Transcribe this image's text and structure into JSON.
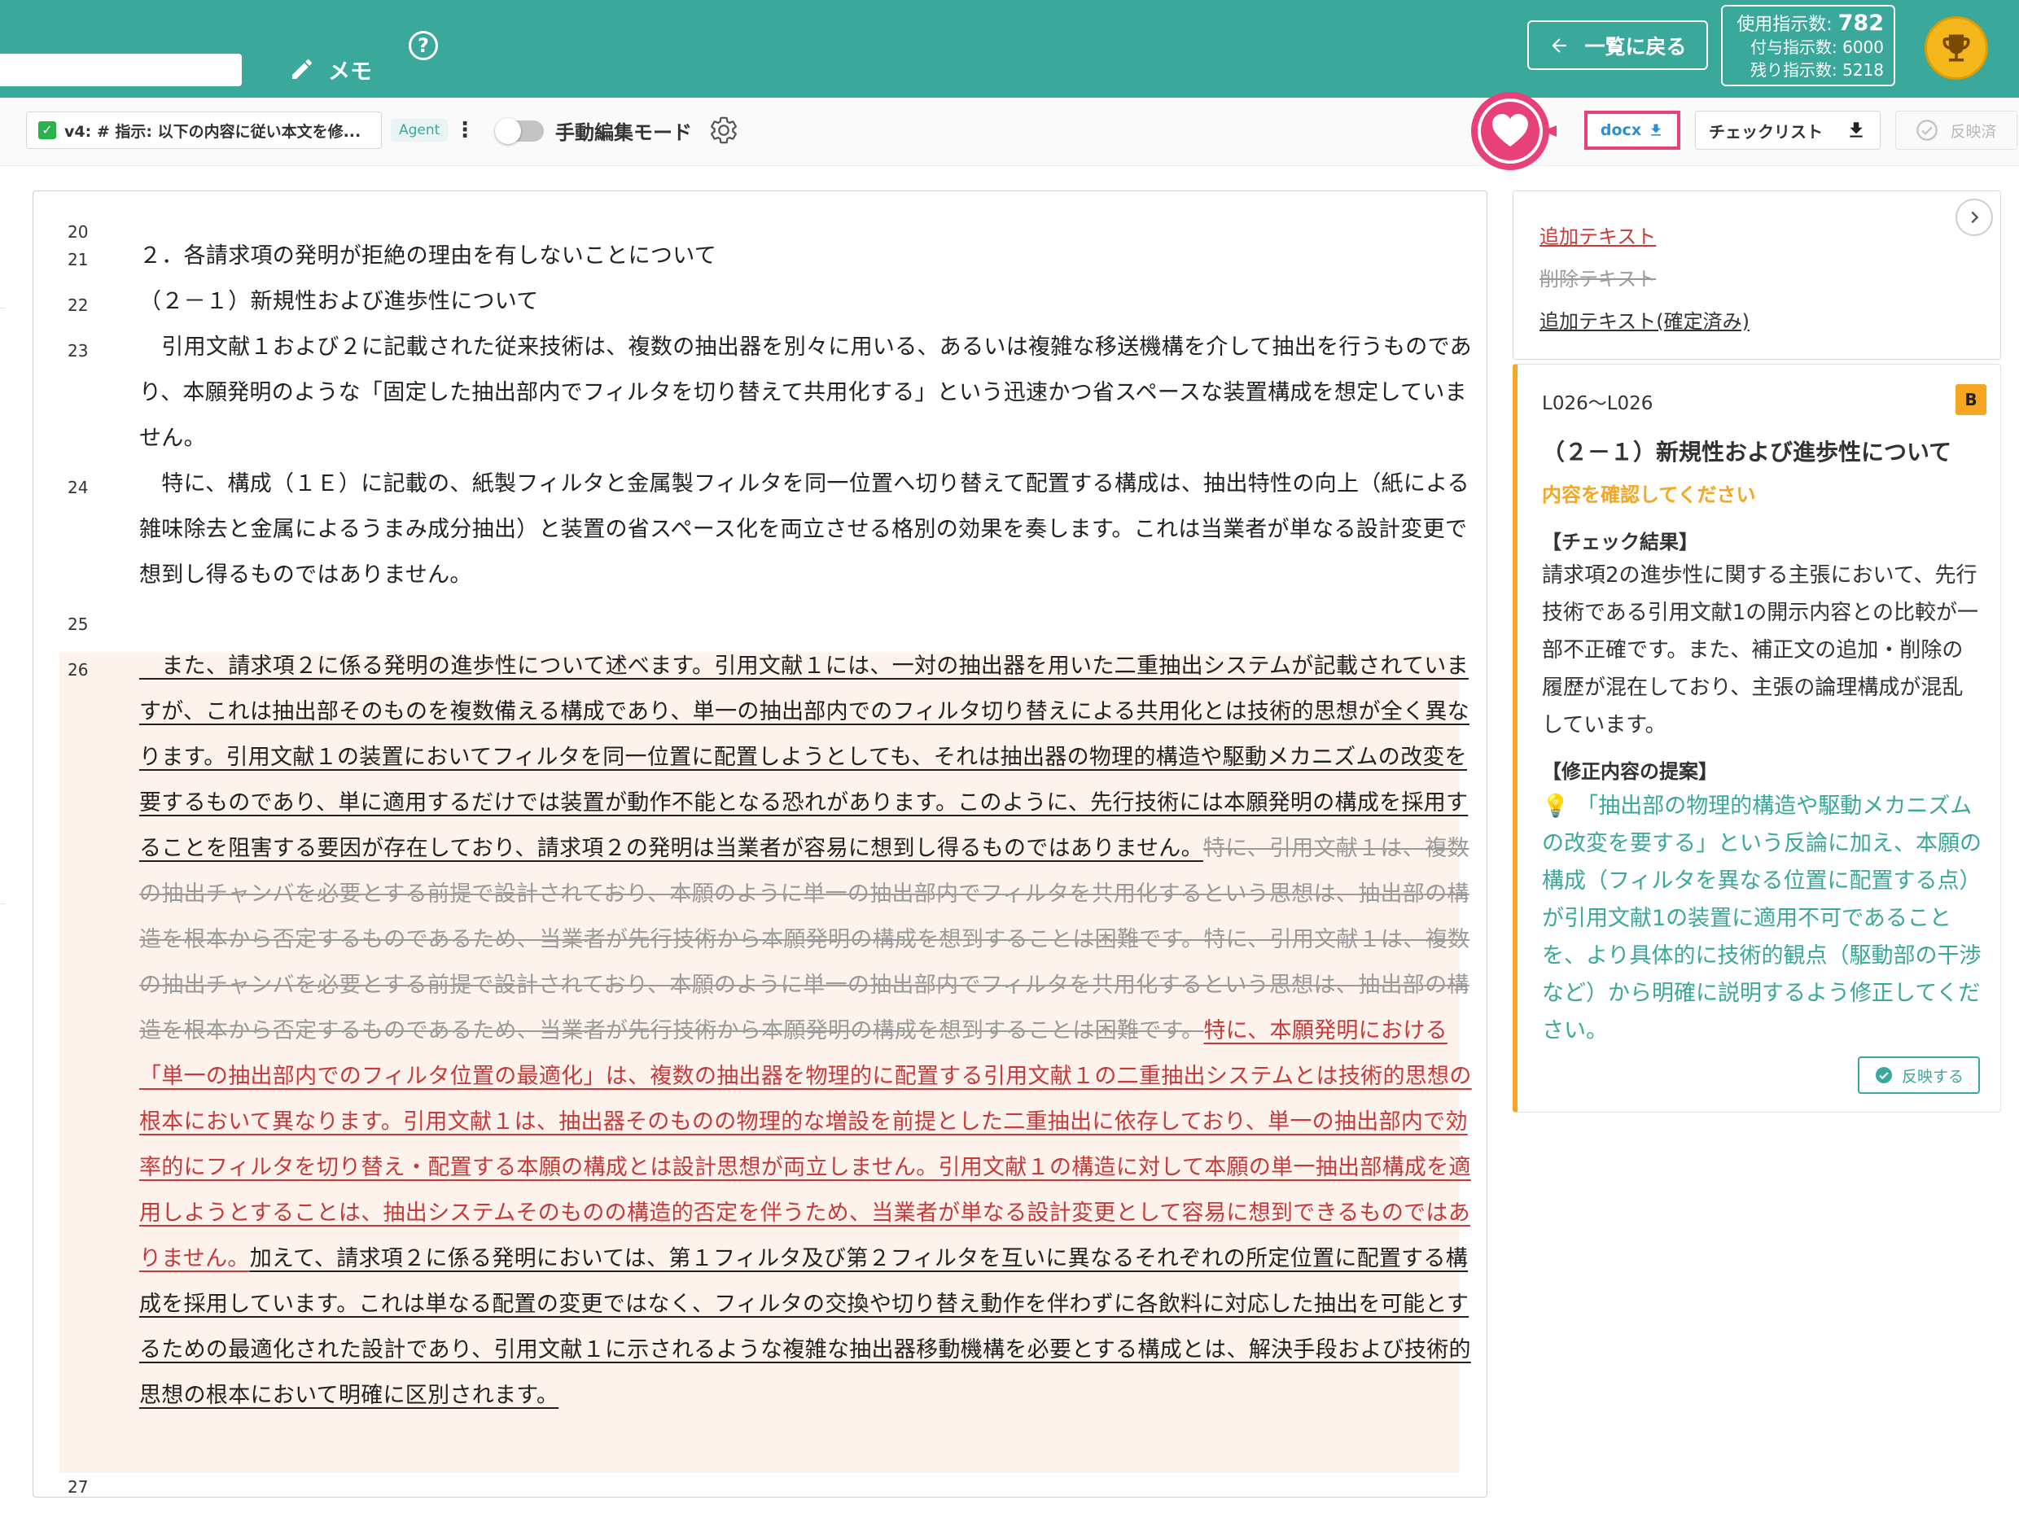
{
  "header": {
    "memo_label": "メモ",
    "help_label": "?",
    "back_label": "一覧に戻る",
    "usage_label": "使用指示数:",
    "usage_value": "782",
    "granted_label": "付与指示数: 6000",
    "remaining_label": "残り指示数: 5218",
    "brand_color": "#3aa89a"
  },
  "toolbar": {
    "version_label": "v4: # 指示: 以下の内容に従い本文を修...",
    "agent_badge": "Agent",
    "manual_mode_label": "手動編集モード",
    "docx_label": "docx",
    "checklist_label": "チェックリスト",
    "reflected_label": "反映済"
  },
  "editor": {
    "lines": [
      {
        "num": "20",
        "text": ""
      },
      {
        "num": "21",
        "text": "２．各請求項の発明が拒絶の理由を有しないことについて"
      },
      {
        "num": "22",
        "text": "（２－１）新規性および進歩性について"
      },
      {
        "num": "23",
        "text": "　引用文献１および２に記載された従来技術は、複数の抽出器を別々に用いる、あるいは複雑な移送機構を介して抽出を行うものであり、本願発明のような「固定した抽出部内でフィルタを切り替えて共用化する」という迅速かつ省スペースな装置構成を想定していません。"
      },
      {
        "num": "24",
        "text": "　特に、構成（１Ｅ）に記載の、紙製フィルタと金属製フィルタを同一位置へ切り替えて配置する構成は、抽出特性の向上（紙による雑味除去と金属によるうまみ成分抽出）と装置の省スペース化を両立させる格別の効果を奏します。これは当業者が単なる設計変更で想到し得るものではありません。"
      },
      {
        "num": "25",
        "text": ""
      },
      {
        "num": "26",
        "segments": [
          {
            "type": "added",
            "text": "　また、請求項２に係る発明の進歩性について述べます。引用文献１には、一対の抽出器を用いた二重抽出システムが記載されていますが、これは抽出部そのものを複数備える構成であり、単一の抽出部内でのフィルタ切り替えによる共用化とは技術的思想が全く異なります。引用文献１の装置においてフィルタを同一位置に配置しようとしても、それは抽出器の物理的構造や駆動メカニズムの改変を要するものであり、単に適用するだけでは装置が動作不能となる恐れがあります。このように、先行技術には本願発明の構成を採用することを阻害する要因が存在しており、請求項２の発明は当業者が容易に想到し得るものではありません。"
          },
          {
            "type": "deleted",
            "text": "特に、引用文献１は、複数の抽出チャンバを必要とする前提で設計されており、本願のように単一の抽出部内でフィルタを共用化するという思想は、抽出部の構造を根本から否定するものであるため、当業者が先行技術から本願発明の構成を想到することは困難です。特に、引用文献１は、複数の抽出チャンバを必要とする前提で設計されており、本願のように単一の抽出部内でフィルタを共用化するという思想は、抽出部の構造を根本から否定するものであるため、当業者が先行技術から本願発明の構成を想到することは困難です。"
          },
          {
            "type": "red",
            "text": "特に、本願発明における「単一の抽出部内でのフィルタ位置の最適化」は、複数の抽出器を物理的に配置する引用文献１の二重抽出システムとは技術的思想の根本において異なります。引用文献１は、抽出器そのものの物理的な増設を前提とした二重抽出に依存しており、単一の抽出部内で効率的にフィルタを切り替え・配置する本願の構成とは設計思想が両立しません。引用文献１の構造に対して本願の単一抽出部構成を適用しようとすることは、抽出システムそのものの構造的否定を伴うため、当業者が単なる設計変更として容易に想到できるものではありません。"
          },
          {
            "type": "added",
            "text": "加えて、請求項２に係る発明においては、第１フィルタ及び第２フィルタを互いに異なるそれぞれの所定位置に配置する構成を採用しています。これは単なる配置の変更ではなく、フィルタの交換や切り替え動作を伴わずに各飲料に対応した抽出を可能とするための最適化された設計であり、引用文献１に示されるような複雑な抽出器移動機構を必要とする構成とは、解決手段および技術的思想の根本において明確に区別されます。"
          }
        ]
      },
      {
        "num": "27",
        "text": ""
      }
    ]
  },
  "legend": {
    "added": "追加テキスト",
    "deleted": "削除テキスト",
    "confirmed": "追加テキスト(確定済み)"
  },
  "card": {
    "range": "L026〜L026",
    "grade": "B",
    "title": "（２－１）新規性および進歩性について",
    "warning": "内容を確認してください",
    "result_heading": "【チェック結果】",
    "result_body": "請求項2の進歩性に関する主張において、先行技術である引用文献1の開示内容との比較が一部不正確です。また、補正文の追加・削除の履歴が混在しており、主張の論理構成が混乱しています。",
    "suggest_heading": "【修正内容の提案】",
    "suggest_body": "💡 「抽出部の物理的構造や駆動メカニズムの改変を要する」という反論に加え、本願の構成（フィルタを異なる位置に配置する点）が引用文献1の装置に適用不可であることを、より具体的に技術的観点（駆動部の干渉など）から明確に説明するよう修正してください。",
    "apply_label": "反映する",
    "accent_color": "#f6a623"
  }
}
